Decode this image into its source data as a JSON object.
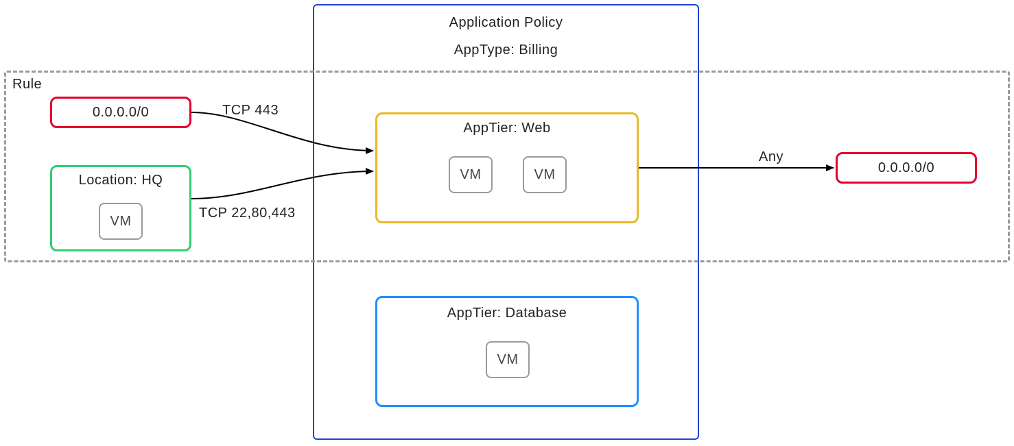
{
  "colors": {
    "policy_border": "#1f43d6",
    "rule_border": "#9a9a9a",
    "source_any_border": "#e4002b",
    "dest_any_border": "#e4002b",
    "location_border": "#2ecc71",
    "web_tier_border": "#e8b923",
    "db_tier_border": "#1e90ff",
    "vm_border": "#9a9a9a",
    "arrow": "#000000"
  },
  "policy": {
    "title": "Application Policy",
    "subtitle": "AppType: Billing"
  },
  "rule": {
    "label": "Rule"
  },
  "sources": {
    "any_cidr": "0.0.0.0/0",
    "location": {
      "label": "Location: HQ",
      "vm": "VM"
    }
  },
  "dest": {
    "any_cidr": "0.0.0.0/0"
  },
  "tiers": {
    "web": {
      "label": "AppTier: Web",
      "vm1": "VM",
      "vm2": "VM"
    },
    "db": {
      "label": "AppTier: Database",
      "vm": "VM"
    }
  },
  "edges": {
    "tcp443": "TCP 443",
    "tcp_multi": "TCP 22,80,443",
    "any": "Any"
  }
}
